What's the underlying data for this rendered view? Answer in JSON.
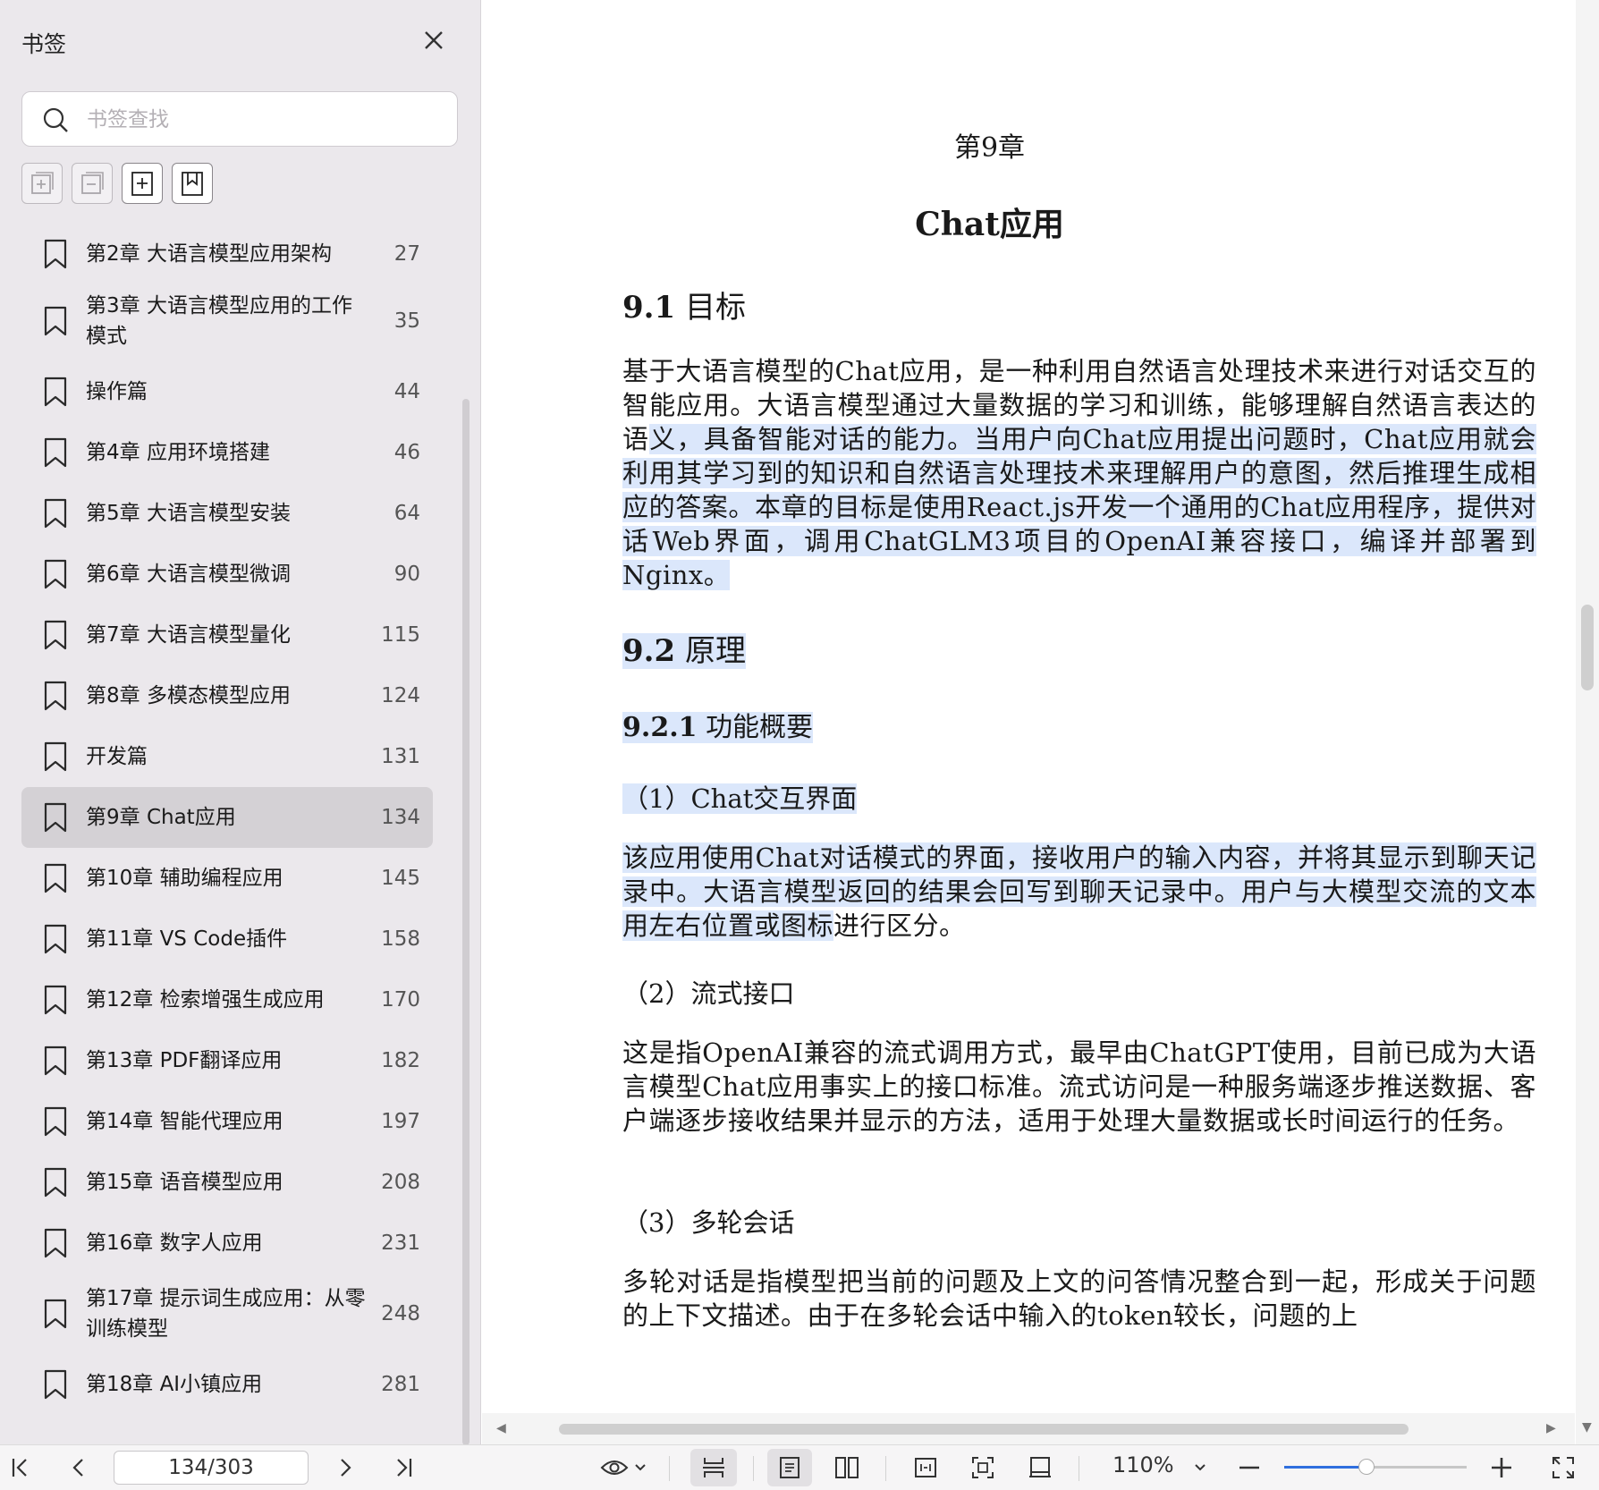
{
  "sidebar": {
    "title": "书签",
    "search_placeholder": "书签查找",
    "bookmarks": [
      {
        "label": "第2章 大语言模型应用架构",
        "page": "27"
      },
      {
        "label": "第3章 大语言模型应用的工作模式",
        "page": "35"
      },
      {
        "label": "操作篇",
        "page": "44"
      },
      {
        "label": "第4章 应用环境搭建",
        "page": "46"
      },
      {
        "label": "第5章 大语言模型安装",
        "page": "64"
      },
      {
        "label": "第6章 大语言模型微调",
        "page": "90"
      },
      {
        "label": "第7章 大语言模型量化",
        "page": "115"
      },
      {
        "label": "第8章 多模态模型应用",
        "page": "124"
      },
      {
        "label": "开发篇",
        "page": "131"
      },
      {
        "label": "第9章 Chat应用",
        "page": "134"
      },
      {
        "label": "第10章 辅助编程应用",
        "page": "145"
      },
      {
        "label": "第11章 VS Code插件",
        "page": "158"
      },
      {
        "label": "第12章 检索增强生成应用",
        "page": "170"
      },
      {
        "label": "第13章 PDF翻译应用",
        "page": "182"
      },
      {
        "label": "第14章 智能代理应用",
        "page": "197"
      },
      {
        "label": "第15章 语音模型应用",
        "page": "208"
      },
      {
        "label": "第16章 数字人应用",
        "page": "231"
      },
      {
        "label": "第17章 提示词生成应用：从零训练模型",
        "page": "248"
      },
      {
        "label": "第18章 AI小镇应用",
        "page": "281"
      }
    ],
    "selected_index": 9
  },
  "document": {
    "chapter_number": "第9章",
    "chapter_title": "Chat应用",
    "s1_num": "9.1",
    "s1_title": "目标",
    "p1_plain": "基于大语言模型的Chat应用，是一种利用自然语言处理技术来进行对话交互的智能应用。大语言模型通过大量数据的学习和训练，能够理解自然语言表达的语",
    "p1_highlight": "义，具备智能对话的能力。当用户向Chat应用提出问题时，Chat应用就会利用其学习到的知识和自然语言处理技术来理解用户的意图，然后推理生成相应的答案。本章的目标是使用React.js开发一个通用的Chat应用程序，提供对话Web界面，调用ChatGLM3项目的OpenAI兼容接口，编译并部署到Nginx。",
    "s2_num": "9.2",
    "s2_title": "原理",
    "s21_num": "9.2.1",
    "s21_title": "功能概要",
    "item1_title": "（1）Chat交互界面",
    "p2_highlight": "该应用使用Chat对话模式的界面，接收用户的输入内容，并将其显示到聊天记录中。大语言模型返回的结果会回写到聊天记录中。用户与大模型交流的文本用左右位置或图标",
    "p2_plain": "进行区分。",
    "item2_title": "（2）流式接口",
    "p3": "这是指OpenAI兼容的流式调用方式，最早由ChatGPT使用，目前已成为大语言模型Chat应用事实上的接口标准。流式访问是一种服务端逐步推送数据、客户端逐步接收结果并显示的方法，适用于处理大量数据或长时间运行的任务。",
    "item3_title": "（3）多轮会话",
    "p4": "多轮对话是指模型把当前的问题及上文的问答情况整合到一起，形成关于问题的上下文描述。由于在多轮会话中输入的token较长，问题的上"
  },
  "toolbar": {
    "page_value": "134/303",
    "zoom_label": "110%",
    "zoom_slider_fraction": 0.45
  },
  "colors": {
    "highlight": "#dbe7fb",
    "sidebar_bg": "#ebe8ec",
    "accent": "#2f6fde"
  }
}
